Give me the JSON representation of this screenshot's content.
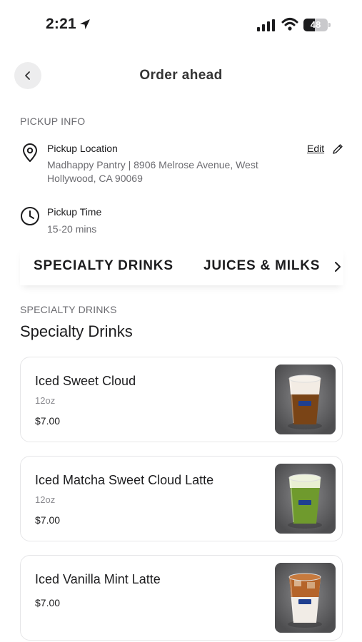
{
  "status_bar": {
    "time": "2:21",
    "battery_level": "48",
    "icons": [
      "location-arrow-icon",
      "signal-icon",
      "wifi-icon",
      "battery-icon"
    ]
  },
  "header": {
    "title": "Order ahead",
    "back_icon": "chevron-left-icon"
  },
  "pickup_info": {
    "section_label": "PICKUP INFO",
    "location": {
      "title": "Pickup Location",
      "text": "Madhappy Pantry | 8906 Melrose Avenue, West Hollywood, CA 90069",
      "edit_label": "Edit",
      "icon": "map-pin-icon"
    },
    "time": {
      "title": "Pickup Time",
      "text": "15-20 mins",
      "icon": "clock-icon"
    }
  },
  "category_tabs": {
    "tabs": [
      "SPECIALTY DRINKS",
      "JUICES & MILKS"
    ],
    "more_icon": "chevron-right-icon"
  },
  "menu_section": {
    "label": "SPECIALTY DRINKS",
    "heading": "Specialty Drinks",
    "products": [
      {
        "name": "Iced Sweet Cloud",
        "size": "12oz",
        "price": "$7.00",
        "drink_colors": [
          "#f3ece4",
          "#7a4416"
        ]
      },
      {
        "name": "Iced Matcha Sweet Cloud Latte",
        "size": "12oz",
        "price": "$7.00",
        "drink_colors": [
          "#e9efd2",
          "#6f9a2d"
        ]
      },
      {
        "name": "Iced Vanilla Mint Latte",
        "size": "",
        "price": "$7.00",
        "drink_colors": [
          "#b5642a",
          "#f1ece6"
        ]
      }
    ]
  }
}
